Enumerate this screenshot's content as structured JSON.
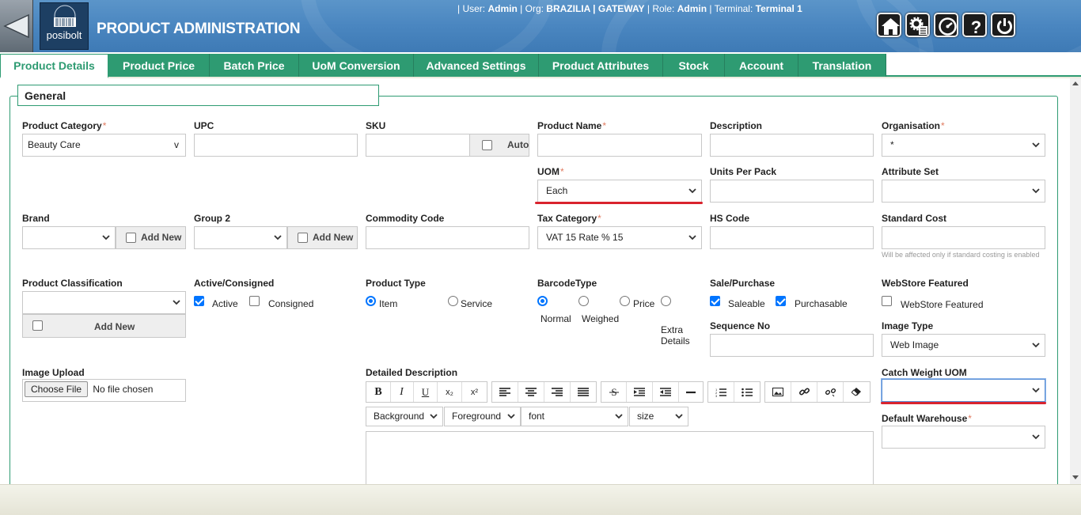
{
  "header": {
    "app_title": "PRODUCT ADMINISTRATION",
    "logo_text": "posibolt",
    "user_label": "| User:",
    "user": "Admin",
    "org_label": "| Org:",
    "org": "BRAZILIA | GATEWAY",
    "role_label": "| Role:",
    "role": "Admin",
    "terminal_label": "| Terminal:",
    "terminal": "Terminal 1",
    "icons": [
      "home-icon",
      "settings-icon",
      "dashboard-icon",
      "help-icon",
      "power-icon"
    ]
  },
  "tabs": [
    {
      "label": "Product Details",
      "active": true
    },
    {
      "label": "Product Price"
    },
    {
      "label": "Batch Price"
    },
    {
      "label": "UoM Conversion"
    },
    {
      "label": "Advanced Settings"
    },
    {
      "label": "Product Attributes"
    },
    {
      "label": "Stock"
    },
    {
      "label": "Account"
    },
    {
      "label": "Translation"
    }
  ],
  "general": {
    "legend": "General",
    "product_category": {
      "label": "Product Category",
      "value": "Beauty Care",
      "arrow": "v"
    },
    "upc": {
      "label": "UPC",
      "value": ""
    },
    "sku": {
      "label": "SKU",
      "value": "",
      "auto_label": "Auto"
    },
    "product_name": {
      "label": "Product Name",
      "value": ""
    },
    "description": {
      "label": "Description",
      "value": ""
    },
    "organisation": {
      "label": "Organisation",
      "value": "*"
    },
    "uom": {
      "label": "UOM",
      "value": "Each"
    },
    "units_per_pack": {
      "label": "Units Per Pack",
      "value": ""
    },
    "attribute_set": {
      "label": "Attribute Set",
      "value": ""
    },
    "brand": {
      "label": "Brand",
      "value": "",
      "add_new": "Add New"
    },
    "group2": {
      "label": "Group 2",
      "value": "",
      "add_new": "Add New"
    },
    "commodity_code": {
      "label": "Commodity Code",
      "value": ""
    },
    "tax_category": {
      "label": "Tax Category",
      "value": "VAT 15 Rate % 15"
    },
    "hs_code": {
      "label": "HS Code",
      "value": ""
    },
    "standard_cost": {
      "label": "Standard Cost",
      "value": "",
      "hint": "Will be affected only if standard costing is enabled"
    },
    "product_classification": {
      "label": "Product Classification",
      "value": "",
      "add_new": "Add New"
    },
    "active_consigned": {
      "label": "Active/Consigned",
      "active": "Active",
      "consigned": "Consigned"
    },
    "product_type": {
      "label": "Product Type",
      "item": "Item",
      "service": "Service"
    },
    "barcode_type": {
      "label": "BarcodeType",
      "normal": "Normal",
      "weighed": "Weighed",
      "price": "Price",
      "extra_details": "Extra Details"
    },
    "sale_purchase": {
      "label": "Sale/Purchase",
      "saleable": "Saleable",
      "purchasable": "Purchasable"
    },
    "webstore_featured": {
      "label": "WebStore Featured",
      "option": "WebStore Featured"
    },
    "sequence_no": {
      "label": "Sequence No",
      "value": ""
    },
    "image_type": {
      "label": "Image Type",
      "value": "Web Image"
    },
    "image_upload": {
      "label": "Image Upload",
      "button": "Choose File",
      "status": "No file chosen"
    },
    "detailed_description": {
      "label": "Detailed Description"
    },
    "editor": {
      "bold": "B",
      "italic": "I",
      "underline": "U",
      "subscript": "x₂",
      "superscript": "x²",
      "background": "Background",
      "foreground": "Foreground",
      "font": "font",
      "size": "size"
    },
    "catch_weight_uom": {
      "label": "Catch Weight UOM",
      "value": ""
    },
    "default_warehouse": {
      "label": "Default Warehouse",
      "value": ""
    }
  },
  "colors": {
    "tab_green": "#2e9b72",
    "header_blue": "#4a86c0",
    "highlight_red": "#d9232e",
    "check_blue": "#0075ff"
  }
}
